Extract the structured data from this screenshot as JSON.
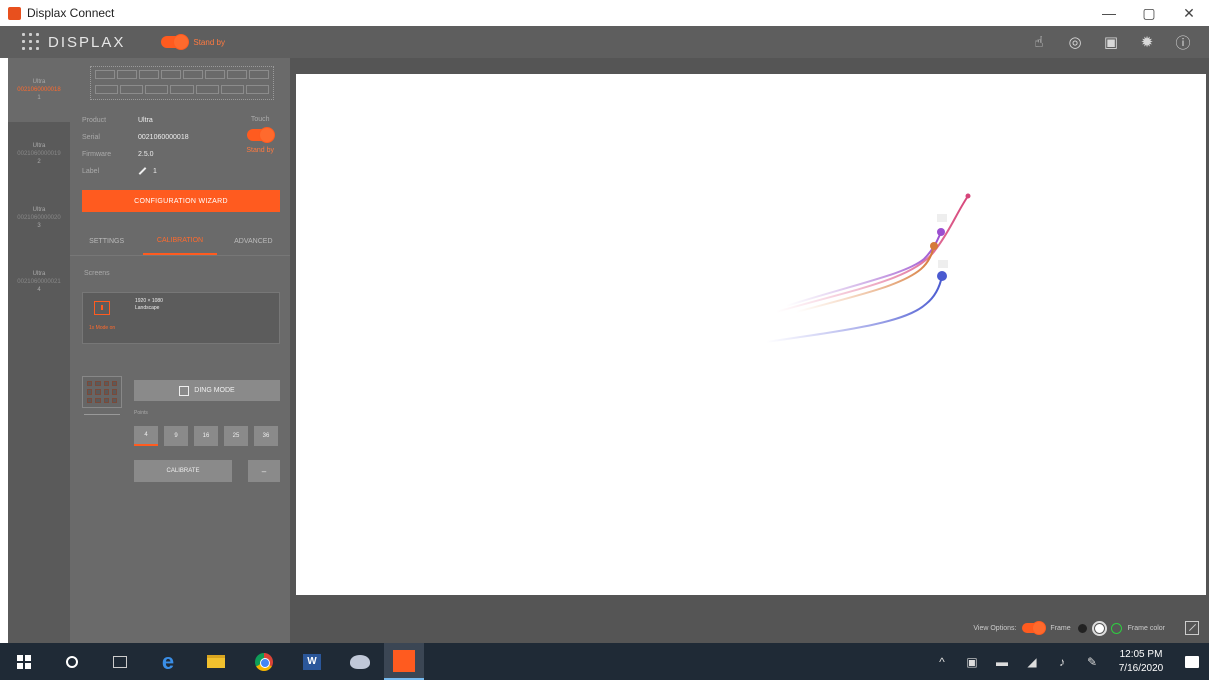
{
  "window": {
    "title": "Displax Connect",
    "controls": [
      "—",
      "▢",
      "✕"
    ]
  },
  "header": {
    "logo": "DISPLAX",
    "standby_label": "Stand by",
    "icons": [
      "touch-icon",
      "stopwatch-icon",
      "download-icon",
      "gear-icon",
      "help-icon"
    ]
  },
  "devices": [
    {
      "name": "Ultra",
      "serial": "0021060000018",
      "index": "1"
    },
    {
      "name": "Ultra",
      "serial": "0021060000019",
      "index": "2"
    },
    {
      "name": "Ultra",
      "serial": "0021060000020",
      "index": "3"
    },
    {
      "name": "Ultra",
      "serial": "0021060000021",
      "index": "4"
    }
  ],
  "panel": {
    "product_label": "Product",
    "product_value": "Ultra",
    "serial_label": "Serial",
    "serial_value": "0021060000018",
    "firmware_label": "Firmware",
    "firmware_value": "2.5.0",
    "label_label": "Label",
    "label_value": "1",
    "touch_label": "Touch",
    "touch_sub": "Stand by",
    "wizard_button": "CONFIGURATION WIZARD",
    "tabs": [
      "SETTINGS",
      "CALIBRATION",
      "ADVANCED"
    ],
    "screens_label": "Screens",
    "screen": {
      "index": "1",
      "sub": "1x Mode on",
      "resolution": "1920 × 1080",
      "orientation": "Landscape"
    },
    "ding_mode": "DING MODE",
    "points_label": "Points",
    "points": [
      "4",
      "9",
      "16",
      "25",
      "36"
    ],
    "calibrate": "CALIBRATE",
    "extra": "–"
  },
  "view_options": {
    "label": "View Options:",
    "frame_label": "Frame",
    "frame_color_label": "Frame color"
  },
  "taskbar": {
    "time": "12:05 PM",
    "date": "7/16/2020"
  },
  "colors": {
    "accent": "#ff5b1f",
    "panel": "#6a6a6a",
    "header": "#5e5e5e"
  }
}
